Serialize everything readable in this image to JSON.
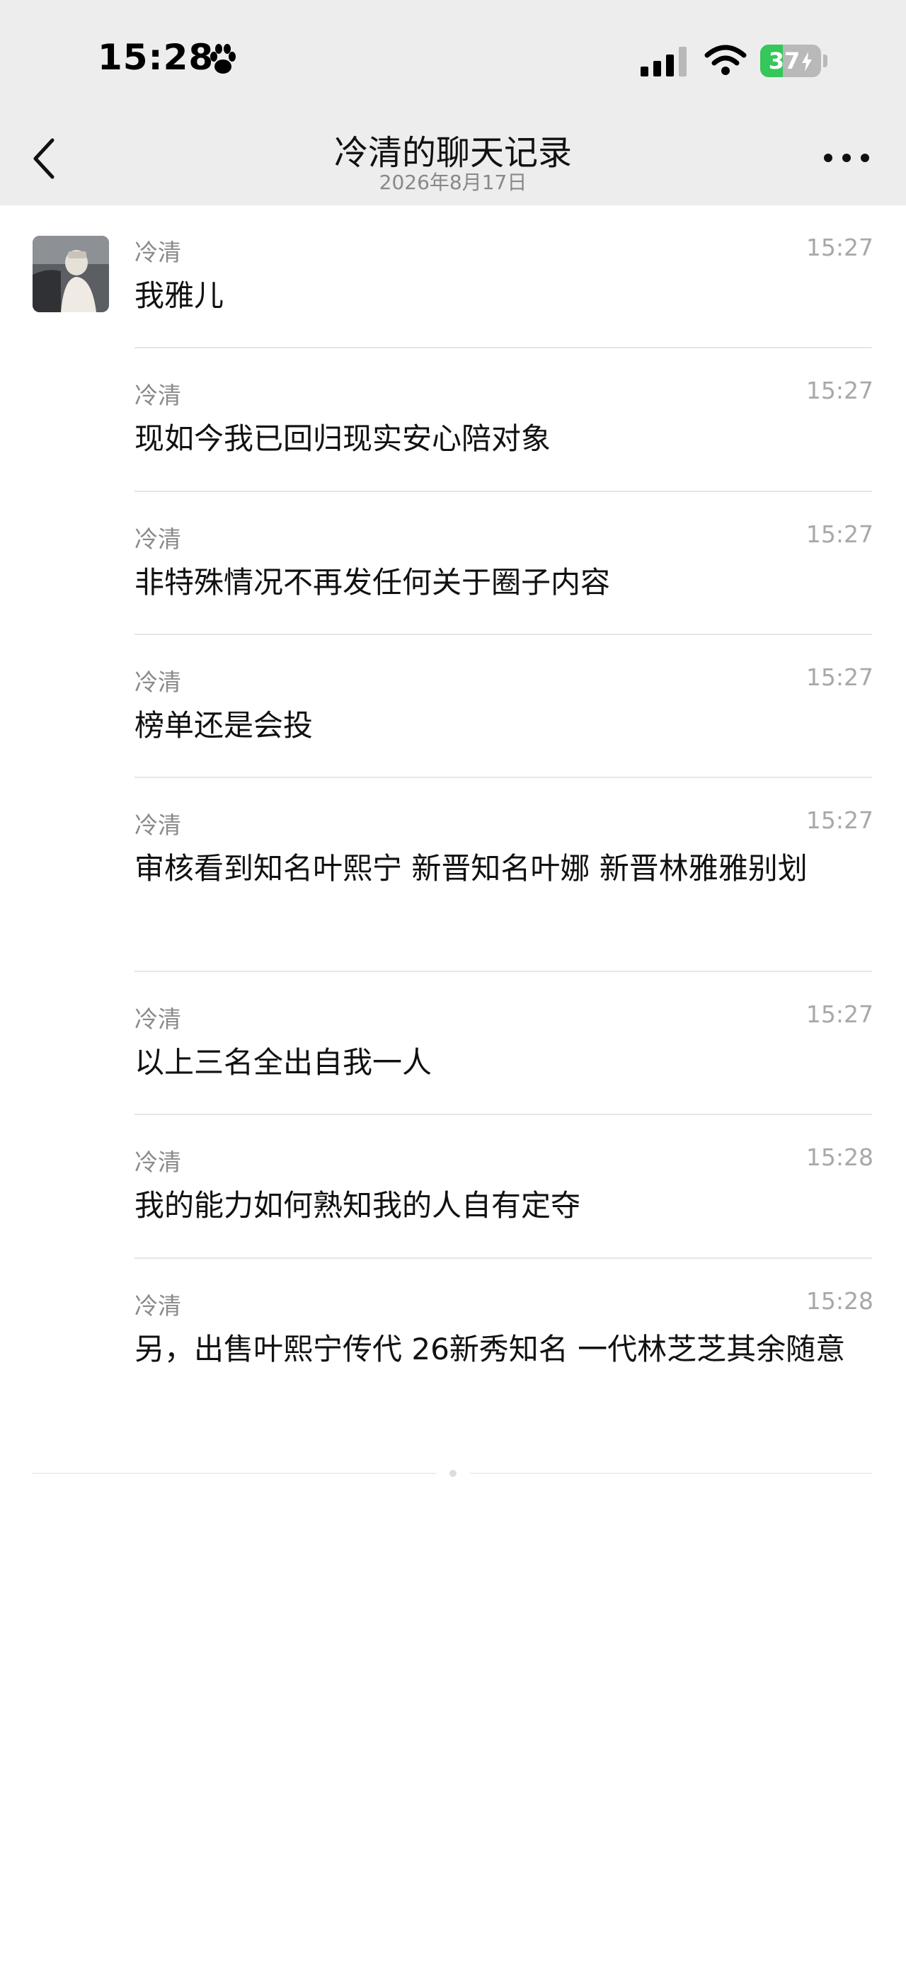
{
  "status_bar": {
    "time": "15:28",
    "battery": "37",
    "battery_level": 0.37,
    "icons": [
      "paw-icon",
      "signal-icon",
      "wifi-icon",
      "battery-charging-icon"
    ]
  },
  "nav": {
    "title": "冷清的聊天记录",
    "subtitle": "2026年8月17日",
    "icons": [
      "back-icon",
      "more-icon"
    ]
  },
  "messages": [
    {
      "sender": "冷清",
      "time": "15:27",
      "text": "我雅儿"
    },
    {
      "sender": "冷清",
      "time": "15:27",
      "text": "现如今我已回归现实安心陪对象"
    },
    {
      "sender": "冷清",
      "time": "15:27",
      "text": "非特殊情况不再发任何关于圈子内容"
    },
    {
      "sender": "冷清",
      "time": "15:27",
      "text": "榜单还是会投"
    },
    {
      "sender": "冷清",
      "time": "15:27",
      "text": "审核看到知名叶熙宁 新晋知名叶娜 新晋林雅雅别划"
    },
    {
      "sender": "冷清",
      "time": "15:27",
      "text": "以上三名全出自我一人"
    },
    {
      "sender": "冷清",
      "time": "15:28",
      "text": "我的能力如何熟知我的人自有定夺"
    },
    {
      "sender": "冷清",
      "time": "15:28",
      "text": "另，出售叶熙宁传代 26新秀知名 一代林芝芝其余随意"
    }
  ]
}
